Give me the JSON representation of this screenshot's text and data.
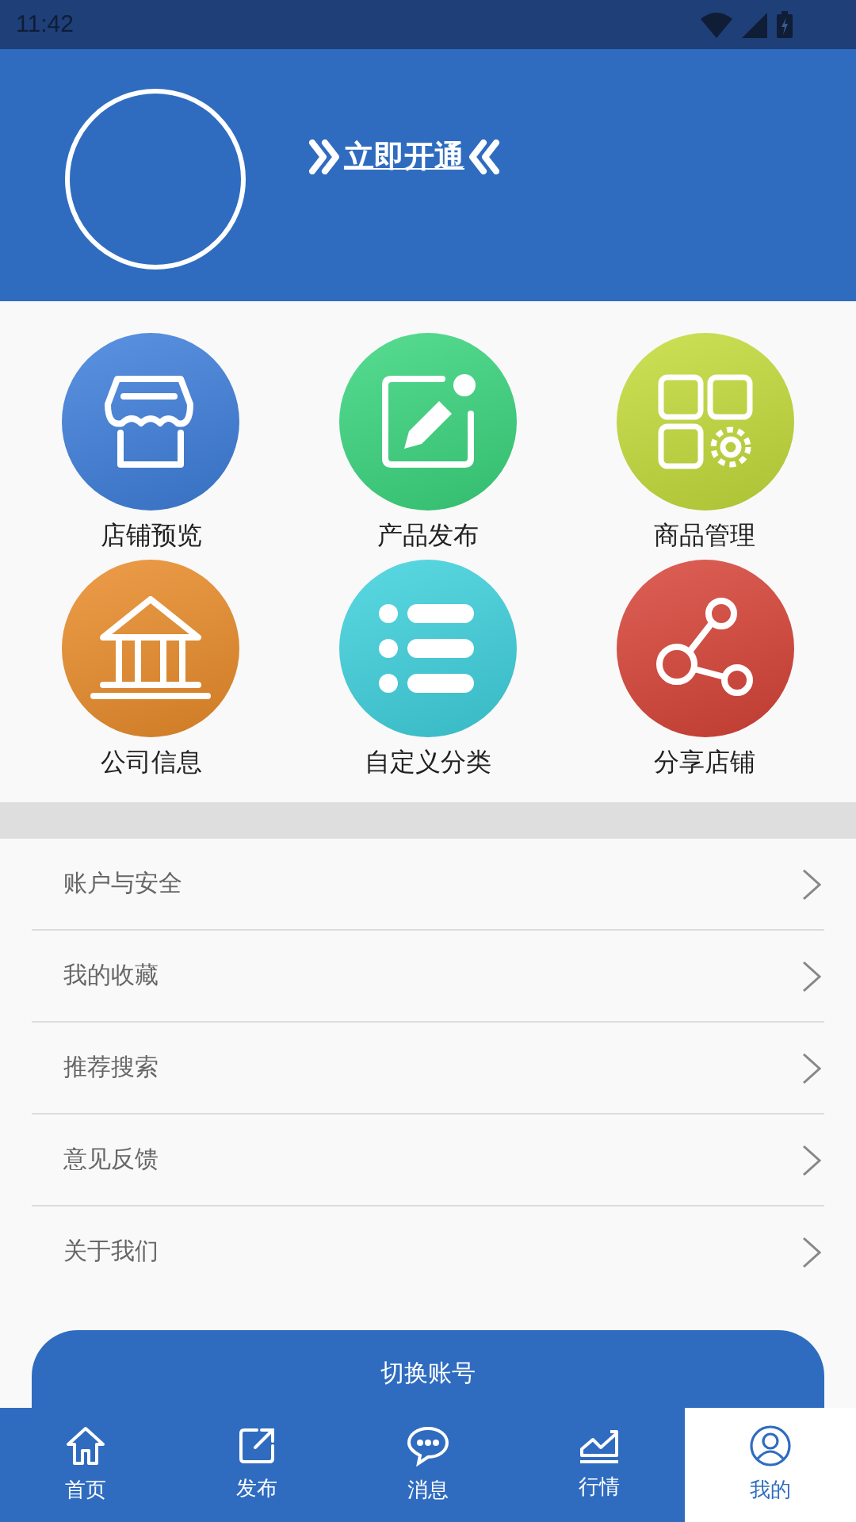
{
  "status_bar": {
    "time": "11:42"
  },
  "header": {
    "promo_link": "立即开通"
  },
  "shortcuts": [
    {
      "kind": "store",
      "label": "店铺预览",
      "color": "#3f7fdc"
    },
    {
      "kind": "edit",
      "label": "产品发布",
      "color": "#3ad67e"
    },
    {
      "kind": "apps",
      "label": "商品管理",
      "color": "#c4dc3a"
    },
    {
      "kind": "bank",
      "label": "公司信息",
      "color": "#ea8c2a"
    },
    {
      "kind": "list",
      "label": "自定义分类",
      "color": "#3fd2de"
    },
    {
      "kind": "share",
      "label": "分享店铺",
      "color": "#d84438"
    }
  ],
  "menu": [
    {
      "label": "账户与安全"
    },
    {
      "label": "我的收藏"
    },
    {
      "label": "推荐搜索"
    },
    {
      "label": "意见反馈"
    },
    {
      "label": "关于我们"
    }
  ],
  "switch_button": "切换账号",
  "tabs": [
    {
      "kind": "home",
      "label": "首页",
      "selected": false
    },
    {
      "kind": "publish",
      "label": "发布",
      "selected": false
    },
    {
      "kind": "chat",
      "label": "消息",
      "selected": false
    },
    {
      "kind": "chart",
      "label": "行情",
      "selected": false
    },
    {
      "kind": "user",
      "label": "我的",
      "selected": true
    }
  ]
}
